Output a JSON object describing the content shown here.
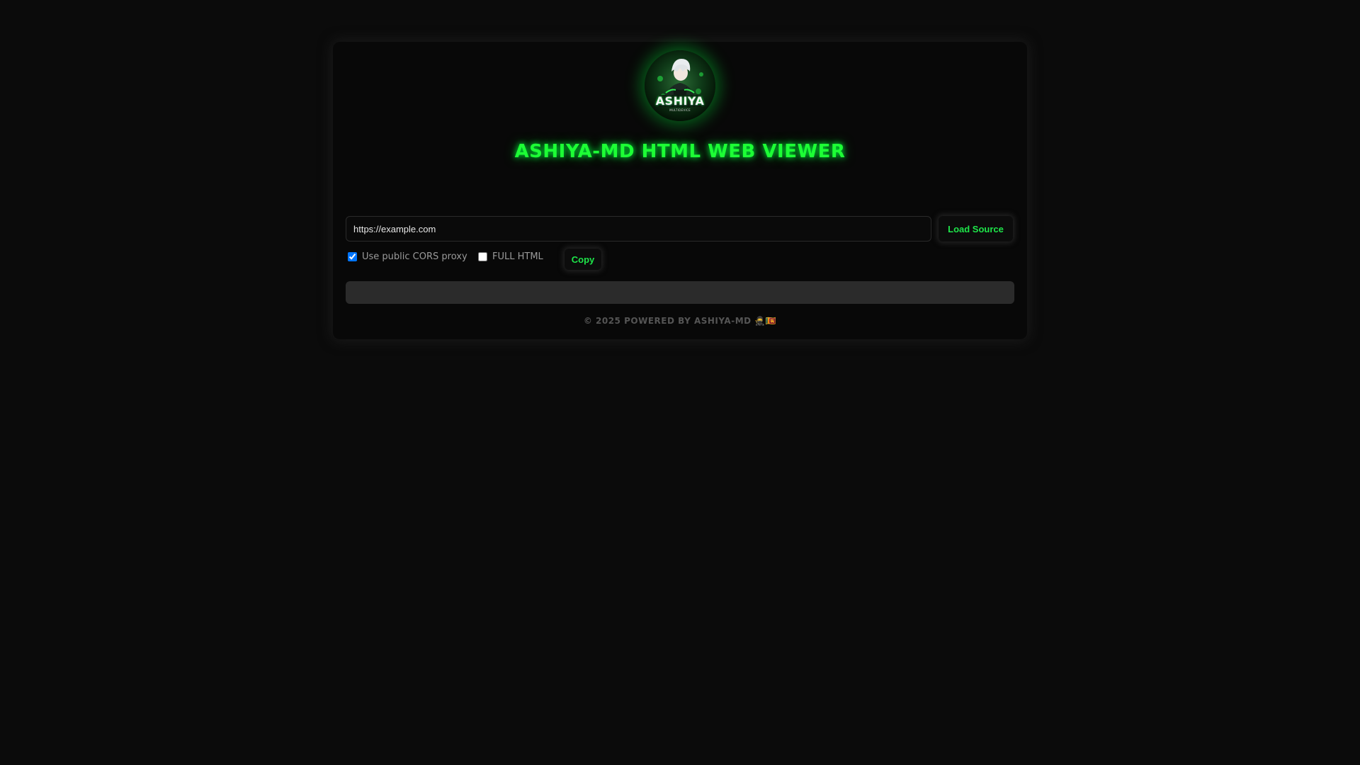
{
  "header": {
    "logo_text": "ASHIYA",
    "logo_subtext": "MULTIDEVICE",
    "title": "ASHIYA-MD HTML WEB VIEWER"
  },
  "form": {
    "url_value": "https://example.com",
    "load_label": "Load Source",
    "cors_label": "Use public CORS proxy",
    "cors_checked": true,
    "full_html_label": "FULL HTML",
    "full_html_checked": false,
    "copy_label": "Copy"
  },
  "footer": {
    "text": "© 2025 POWERED BY ASHIYA-MD 🥷🇱🇰"
  },
  "colors": {
    "background": "#0b0b0b",
    "accent": "#1dff35",
    "card": "#080808",
    "output_box": "#2b2b2b"
  }
}
